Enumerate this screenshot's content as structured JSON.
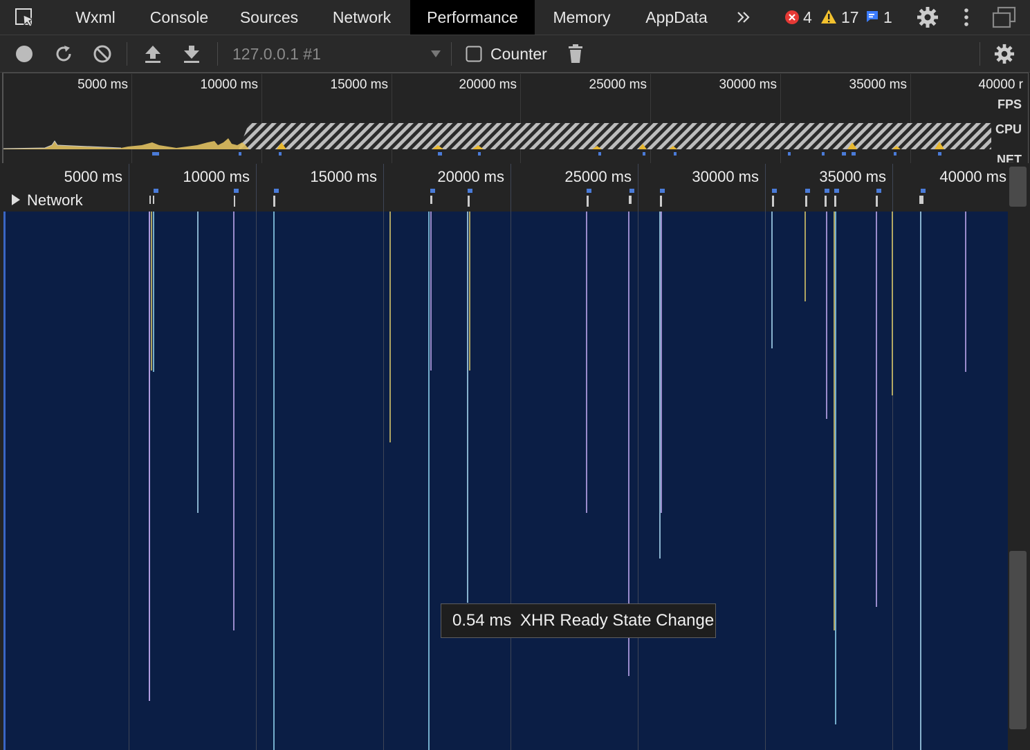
{
  "tabs": [
    {
      "label": "Wxml",
      "active": false
    },
    {
      "label": "Console",
      "active": false
    },
    {
      "label": "Sources",
      "active": false
    },
    {
      "label": "Network",
      "active": false
    },
    {
      "label": "Performance",
      "active": true
    },
    {
      "label": "Memory",
      "active": false
    },
    {
      "label": "AppData",
      "active": false
    }
  ],
  "status": {
    "errors": "4",
    "warnings": "17",
    "messages": "1",
    "error_color": "#e53935",
    "warning_color": "#f2c12e",
    "message_color": "#3b7cff"
  },
  "toolbar": {
    "target": "127.0.0.1 #1",
    "counter_label": "Counter",
    "counter_checked": false
  },
  "overview": {
    "ticks": [
      "5000 ms",
      "10000 ms",
      "15000 ms",
      "20000 ms",
      "25000 ms",
      "30000 ms",
      "35000 ms",
      "40000 r"
    ],
    "fps_label": "FPS",
    "cpu_label": "CPU",
    "net_label": "NET"
  },
  "timeline": {
    "ticks": [
      "5000 ms",
      "10000 ms",
      "15000 ms",
      "20000 ms",
      "25000 ms",
      "30000 ms",
      "35000 ms",
      "40000 ms"
    ],
    "network_label": "Network",
    "background_color": "#0b1e45"
  },
  "tooltip": {
    "duration": "0.54 ms",
    "label": "XHR Ready State Change"
  }
}
